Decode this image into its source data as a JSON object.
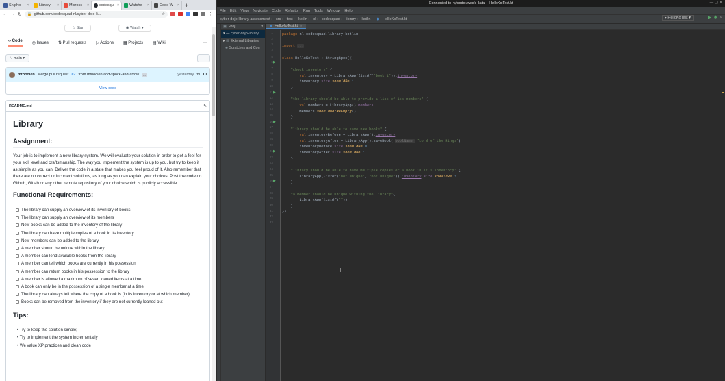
{
  "browser": {
    "tabs": [
      {
        "label": "Shipho",
        "color": "#3b5998"
      },
      {
        "label": "Library",
        "color": "#f4b400"
      },
      {
        "label": "Microsc",
        "color": "#e74c3c"
      },
      {
        "label": "codesqu",
        "color": "#24292f"
      },
      {
        "label": "Watche",
        "color": "#0f9d58"
      },
      {
        "label": "Code W",
        "color": "#444444"
      }
    ],
    "new_tab": "+",
    "url": "github.com/codesquad-nl/cyber-dojo-li...",
    "nav_back": "←",
    "nav_forward": "→",
    "nav_reload": "↻",
    "star_label": "Star",
    "watch_label": "Watch",
    "repo_nav": [
      "Code",
      "Issues",
      "Pull requests",
      "Actions",
      "Projects",
      "Wiki"
    ],
    "more": "···",
    "branch": "main",
    "commit": {
      "author": "mthoolen",
      "message": "Merge pull request",
      "pr": "#2",
      "rest": "from mthoolen/add-spock-and-arrow",
      "ellipsis": "...",
      "when": "yesterday",
      "count": "10"
    },
    "view_code": "View code",
    "readme": {
      "filename": "README.md",
      "title": "Library",
      "assignment_heading": "Assignment:",
      "assignment_text": "Your job is to implement a new library system. We will evaluate your solution in order to get a feel for your skill level and craftsmanship. The way you implement the system is up to you, but try to keep it as simple as you can. Deliver the code in a state that makes you feel proud of it. Also remember that there are no correct or incorrect solutions, as long as you can explain your choices. Post the code on Github, Gitlab or any other remote repository of your choice which is publicly accessible.",
      "functional_heading": "Functional Requirements:",
      "requirements": [
        "The library can supply an overview of its inventory of books",
        "The library can supply an overview of its members",
        "New books can be added to the inventory of the library",
        "The library can have multiple copies of a book in its inventory",
        "New members can be added to the library",
        "A member should be unique within the library",
        "A member can lend available books from the library",
        "A member can tell which books are currently in his possession",
        "A member can return books in his possession to the library",
        "A member is allowed a maximum of seven loaned items at a time",
        "A book can only be in the possession of a single member at a time",
        "The library can always tell where the copy of a book is (in its inventory or at which member)",
        "Books can be removed from the inventory if they are not currently loaned out"
      ],
      "tips_heading": "Tips:",
      "tips": [
        "Try to keep the solution simple;",
        "Try to implement the system incrementally",
        "We value XP practices and clean code"
      ]
    }
  },
  "ide": {
    "window_title": "Connected to hylcodouwes's kata – HelloKoTest.kt",
    "menu": [
      "File",
      "Edit",
      "View",
      "Navigate",
      "Code",
      "Refactor",
      "Run",
      "Tools",
      "Window",
      "Help"
    ],
    "breadcrumbs": [
      "cyber-dojo-library-assessment",
      "src",
      "test",
      "kotlin",
      "nl",
      "codesquad",
      "library",
      "kotlin",
      "HelloKoTest.kt"
    ],
    "run_config": "HelloKoTest",
    "project_panel_title": "Proj...",
    "project_tree": [
      "cyber-dojo-library",
      "External Libraries",
      "Scratches and Con"
    ],
    "editor_tab": "HelloKoTest.kt",
    "line_numbers": [
      "1",
      "2",
      "3",
      "4",
      "5",
      "6",
      "7",
      "8",
      "9",
      "10",
      "11",
      "12",
      "13",
      "14",
      "15",
      "16",
      "17",
      "18",
      "19",
      "20",
      "21",
      "22",
      "23",
      "24",
      "25",
      "26",
      "27",
      "28",
      "29",
      "30",
      "31",
      "32",
      "33"
    ]
  }
}
